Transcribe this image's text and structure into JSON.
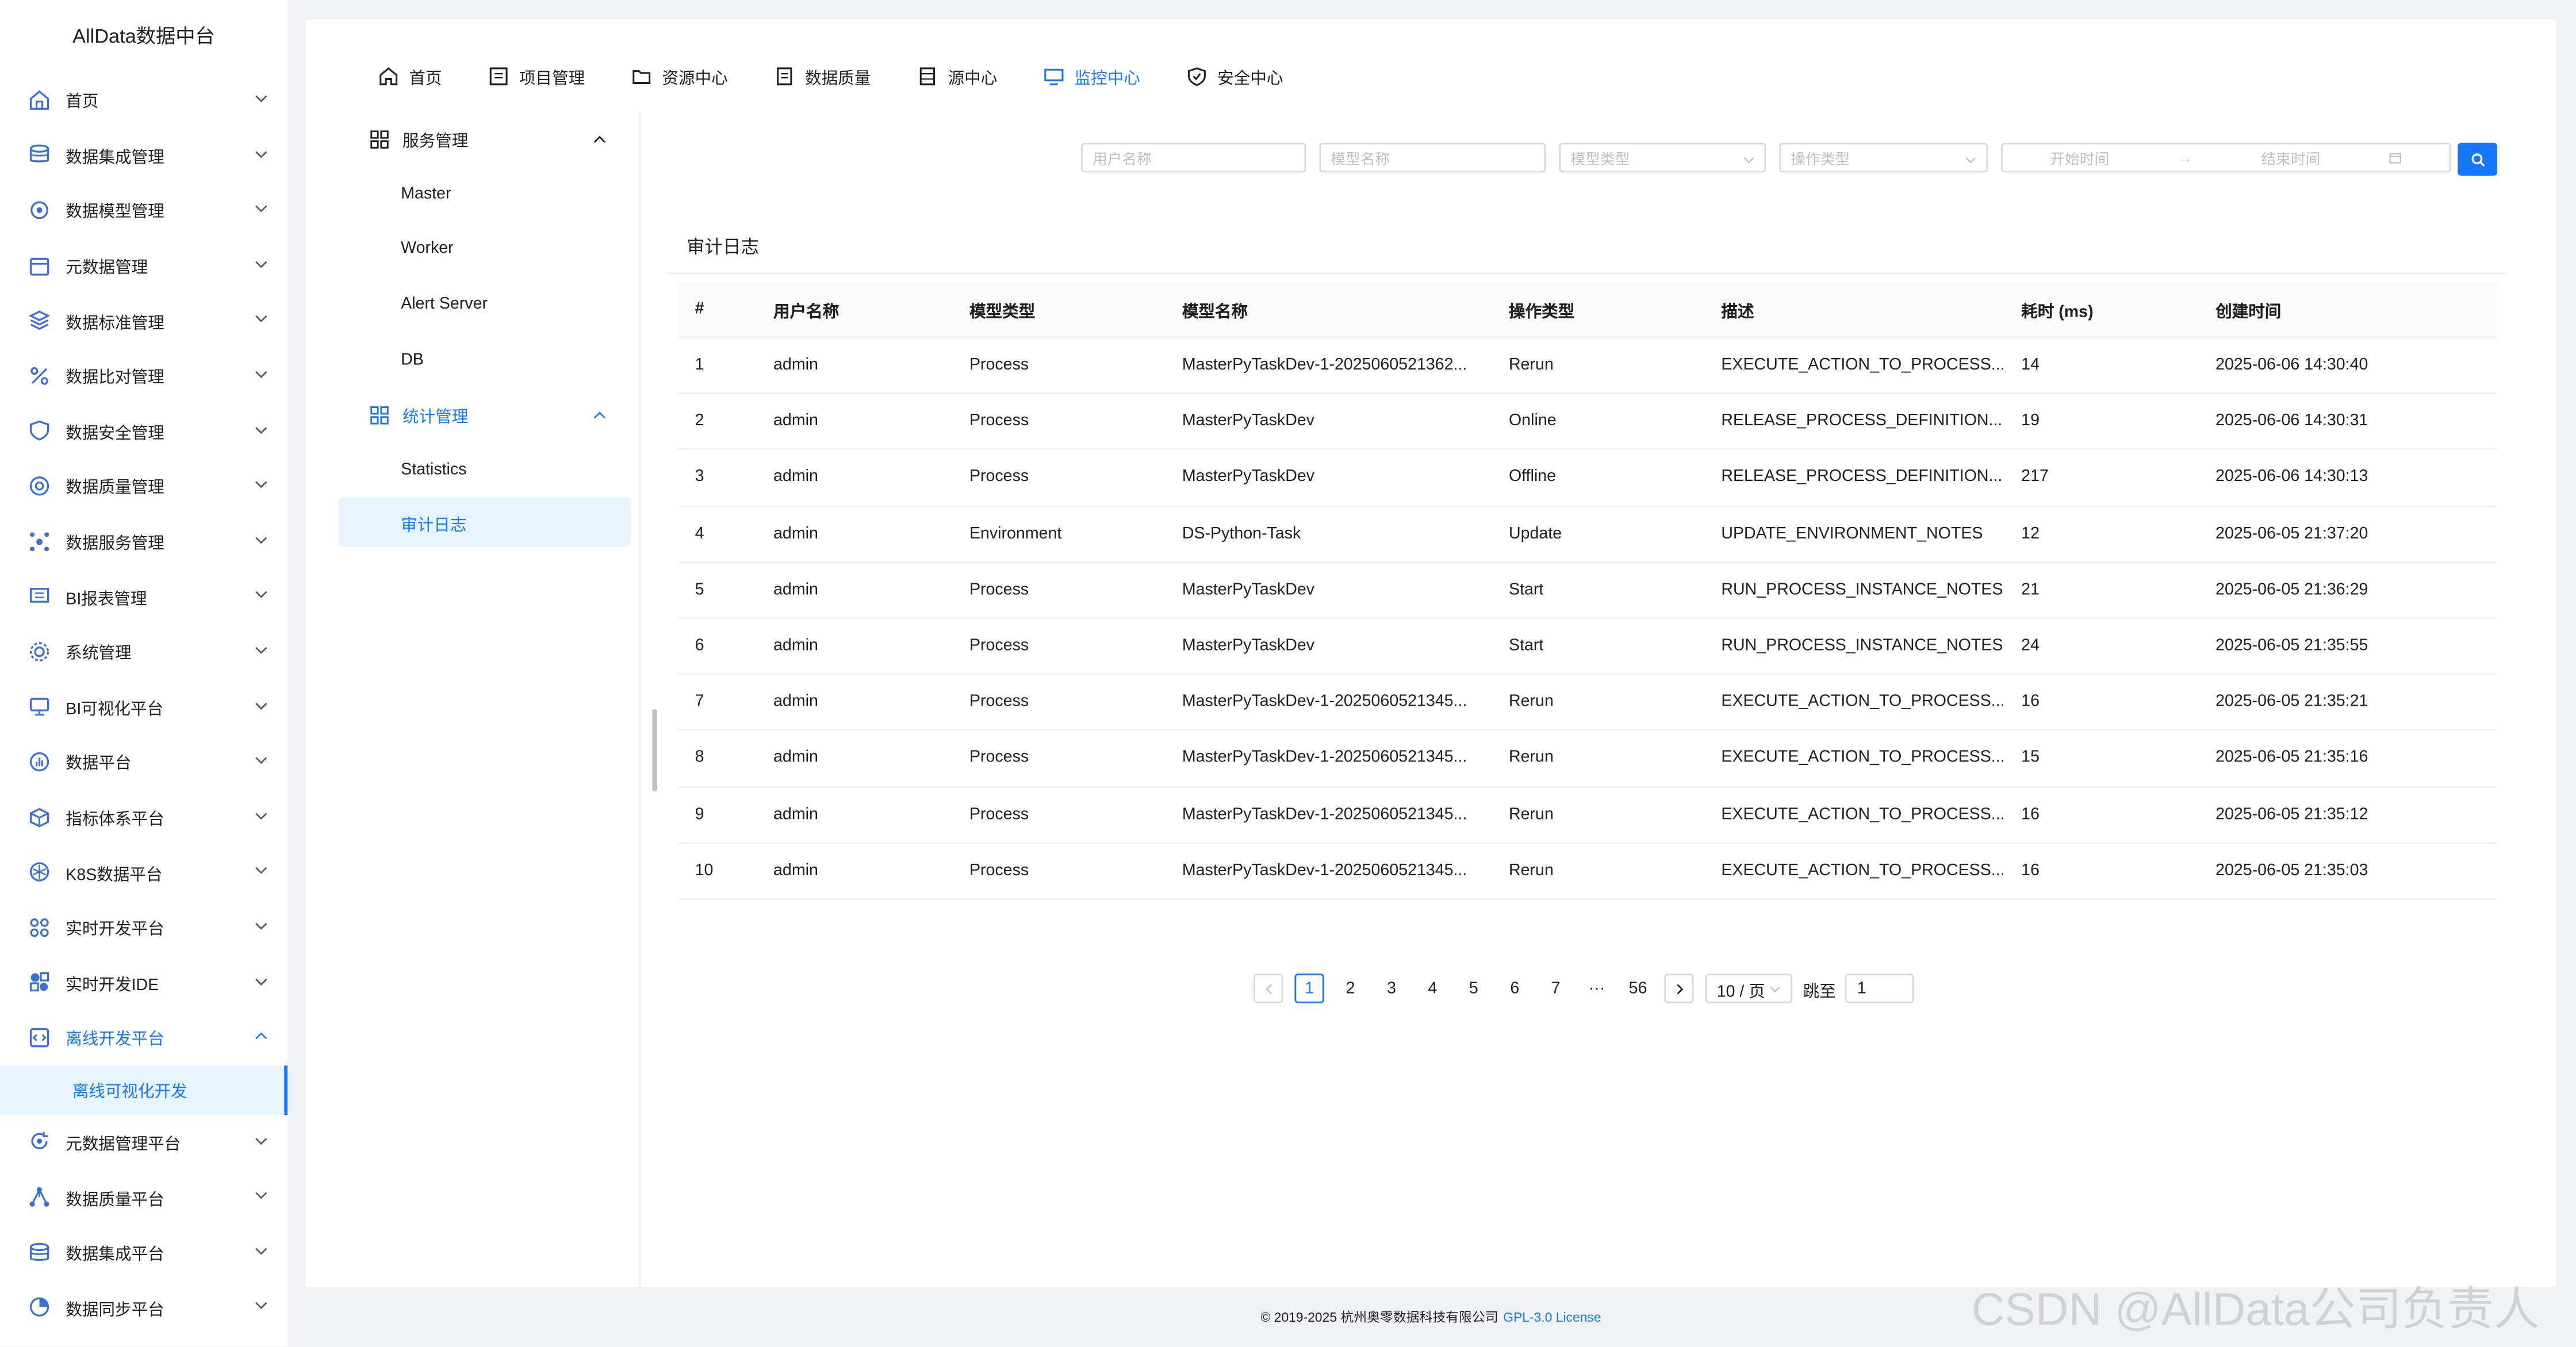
{
  "app": {
    "title": "AllData数据中台"
  },
  "sidebar": {
    "items": [
      {
        "label": "首页",
        "icon": "home-icon"
      },
      {
        "label": "数据集成管理",
        "icon": "database-icon"
      },
      {
        "label": "数据模型管理",
        "icon": "model-icon"
      },
      {
        "label": "元数据管理",
        "icon": "calendar-icon"
      },
      {
        "label": "数据标准管理",
        "icon": "layers-icon"
      },
      {
        "label": "数据比对管理",
        "icon": "percent-icon"
      },
      {
        "label": "数据安全管理",
        "icon": "shield-icon"
      },
      {
        "label": "数据质量管理",
        "icon": "quality-icon"
      },
      {
        "label": "数据服务管理",
        "icon": "service-icon"
      },
      {
        "label": "BI报表管理",
        "icon": "report-icon"
      },
      {
        "label": "系统管理",
        "icon": "gear-icon"
      },
      {
        "label": "BI可视化平台",
        "icon": "monitor-icon"
      },
      {
        "label": "数据平台",
        "icon": "chart-icon"
      },
      {
        "label": "指标体系平台",
        "icon": "cube-icon"
      },
      {
        "label": "K8S数据平台",
        "icon": "k8s-icon"
      },
      {
        "label": "实时开发平台",
        "icon": "grid-icon"
      },
      {
        "label": "实时开发IDE",
        "icon": "ide-icon"
      },
      {
        "label": "离线开发平台",
        "icon": "code-icon",
        "open": true,
        "children": [
          "离线可视化开发"
        ]
      },
      {
        "label": "元数据管理平台",
        "icon": "refresh-icon"
      },
      {
        "label": "数据质量平台",
        "icon": "network-icon"
      },
      {
        "label": "数据集成平台",
        "icon": "database-icon"
      },
      {
        "label": "数据同步平台",
        "icon": "sync-icon"
      }
    ]
  },
  "topnav": {
    "items": [
      {
        "label": "首页",
        "icon": "home-icon"
      },
      {
        "label": "项目管理",
        "icon": "project-icon"
      },
      {
        "label": "资源中心",
        "icon": "folder-icon"
      },
      {
        "label": "数据质量",
        "icon": "document-icon"
      },
      {
        "label": "源中心",
        "icon": "server-icon"
      },
      {
        "label": "监控中心",
        "icon": "monitor-icon",
        "active": true
      },
      {
        "label": "安全中心",
        "icon": "shield-check-icon"
      }
    ]
  },
  "subsidebar": {
    "groups": [
      {
        "label": "服务管理",
        "items": [
          "Master",
          "Worker",
          "Alert Server",
          "DB"
        ]
      },
      {
        "label": "统计管理",
        "active": true,
        "items": [
          "Statistics",
          "审计日志"
        ]
      }
    ]
  },
  "filters": {
    "user_name_placeholder": "用户名称",
    "model_name_placeholder": "模型名称",
    "model_type_placeholder": "模型类型",
    "operation_type_placeholder": "操作类型",
    "start_time_placeholder": "开始时间",
    "end_time_placeholder": "结束时间",
    "range_separator": "→"
  },
  "card": {
    "title": "审计日志"
  },
  "table": {
    "columns": [
      "#",
      "用户名称",
      "模型类型",
      "模型名称",
      "操作类型",
      "描述",
      "耗时 (ms)",
      "创建时间"
    ],
    "rows": [
      [
        "1",
        "admin",
        "Process",
        "MasterPyTaskDev-1-2025060521362...",
        "Rerun",
        "EXECUTE_ACTION_TO_PROCESS...",
        "14",
        "2025-06-06 14:30:40"
      ],
      [
        "2",
        "admin",
        "Process",
        "MasterPyTaskDev",
        "Online",
        "RELEASE_PROCESS_DEFINITION...",
        "19",
        "2025-06-06 14:30:31"
      ],
      [
        "3",
        "admin",
        "Process",
        "MasterPyTaskDev",
        "Offline",
        "RELEASE_PROCESS_DEFINITION...",
        "217",
        "2025-06-06 14:30:13"
      ],
      [
        "4",
        "admin",
        "Environment",
        "DS-Python-Task",
        "Update",
        "UPDATE_ENVIRONMENT_NOTES",
        "12",
        "2025-06-05 21:37:20"
      ],
      [
        "5",
        "admin",
        "Process",
        "MasterPyTaskDev",
        "Start",
        "RUN_PROCESS_INSTANCE_NOTES",
        "21",
        "2025-06-05 21:36:29"
      ],
      [
        "6",
        "admin",
        "Process",
        "MasterPyTaskDev",
        "Start",
        "RUN_PROCESS_INSTANCE_NOTES",
        "24",
        "2025-06-05 21:35:55"
      ],
      [
        "7",
        "admin",
        "Process",
        "MasterPyTaskDev-1-2025060521345...",
        "Rerun",
        "EXECUTE_ACTION_TO_PROCESS...",
        "16",
        "2025-06-05 21:35:21"
      ],
      [
        "8",
        "admin",
        "Process",
        "MasterPyTaskDev-1-2025060521345...",
        "Rerun",
        "EXECUTE_ACTION_TO_PROCESS...",
        "15",
        "2025-06-05 21:35:16"
      ],
      [
        "9",
        "admin",
        "Process",
        "MasterPyTaskDev-1-2025060521345...",
        "Rerun",
        "EXECUTE_ACTION_TO_PROCESS...",
        "16",
        "2025-06-05 21:35:12"
      ],
      [
        "10",
        "admin",
        "Process",
        "MasterPyTaskDev-1-2025060521345...",
        "Rerun",
        "EXECUTE_ACTION_TO_PROCESS...",
        "16",
        "2025-06-05 21:35:03"
      ]
    ]
  },
  "pagination": {
    "pages": [
      "1",
      "2",
      "3",
      "4",
      "5",
      "6",
      "7",
      "···",
      "56"
    ],
    "current": "1",
    "page_size": "10 / 页",
    "jump_label": "跳至",
    "jump_value": "1"
  },
  "footer": {
    "copyright": "© 2019-2025 杭州奥零数据科技有限公司",
    "license": "GPL-3.0 License"
  },
  "watermark": "CSDN @AllData公司负责人",
  "colors": {
    "accent": "#1677ff",
    "selected_bg": "#e6f4ff"
  }
}
